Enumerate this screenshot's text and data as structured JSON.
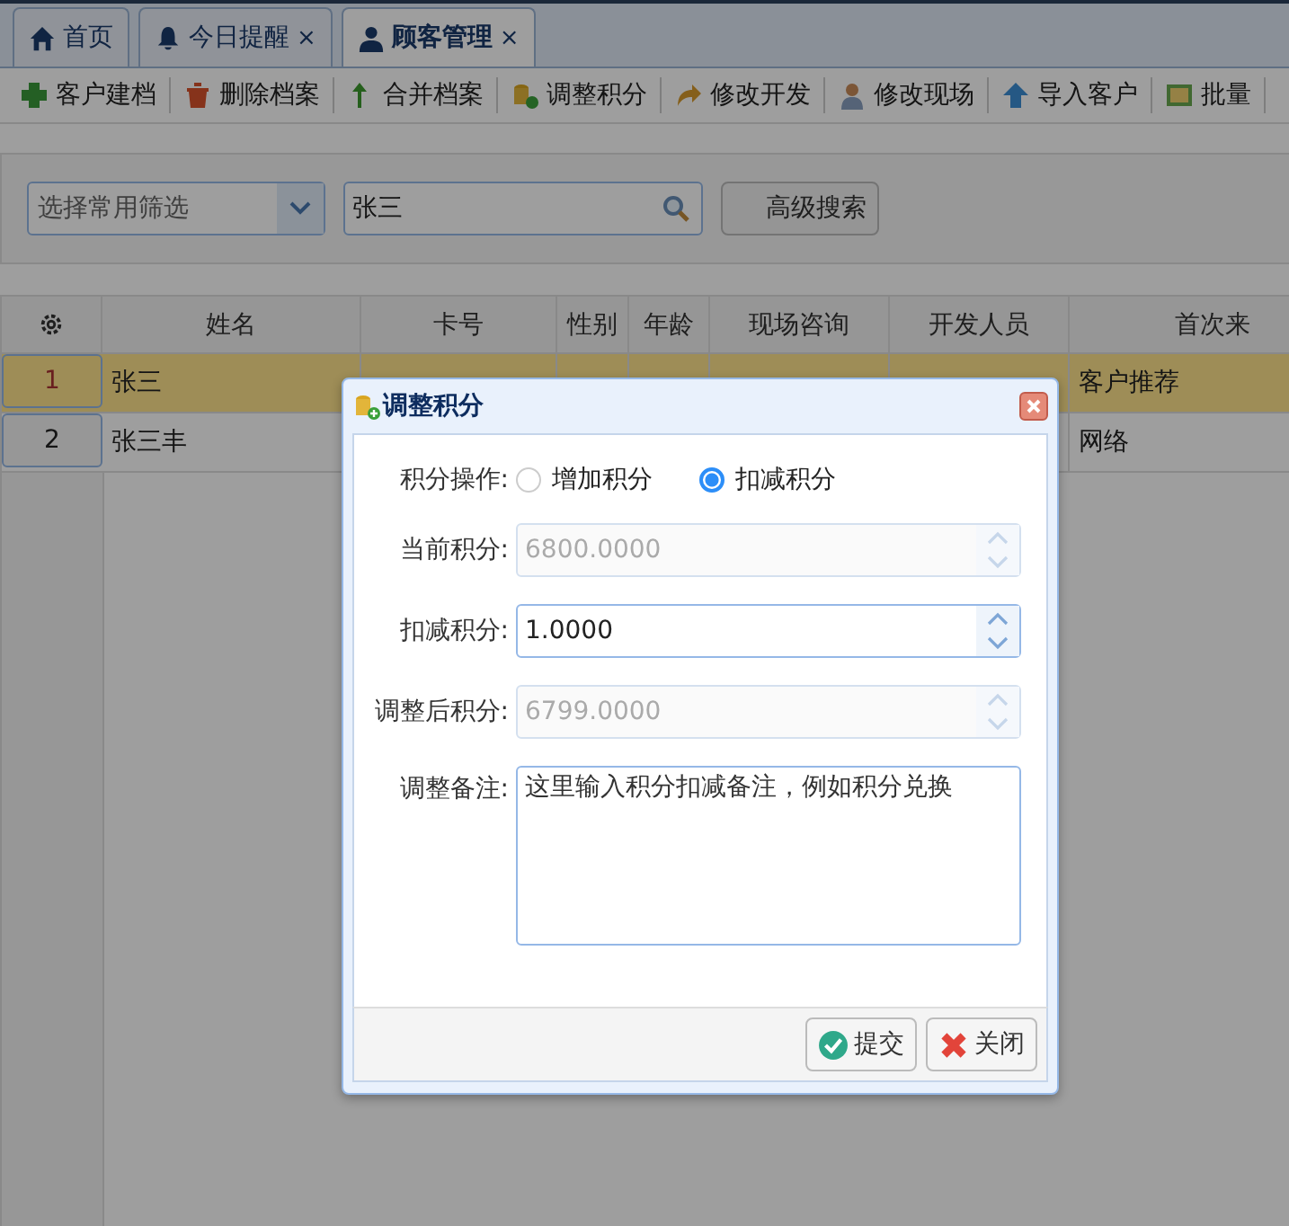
{
  "tabs": [
    {
      "label": "首页",
      "closable": false,
      "selected": false
    },
    {
      "label": "今日提醒",
      "closable": true,
      "selected": false
    },
    {
      "label": "顾客管理",
      "closable": true,
      "selected": true
    }
  ],
  "close_glyph": "×",
  "toolbar": [
    "客户建档",
    "删除档案",
    "合并档案",
    "调整积分",
    "修改开发",
    "修改现场",
    "导入客户",
    "批量"
  ],
  "search": {
    "filter_placeholder": "选择常用筛选",
    "query": "张三",
    "button": "高级搜索"
  },
  "table": {
    "columns": [
      "",
      "姓名",
      "卡号",
      "性别",
      "年龄",
      "现场咨询",
      "开发人员",
      "首次来"
    ],
    "rows": [
      {
        "selected": true,
        "cells": [
          "1",
          "张三",
          null,
          null,
          null,
          null,
          null,
          "客户推荐"
        ]
      },
      {
        "selected": false,
        "cells": [
          "2",
          "张三丰",
          null,
          null,
          null,
          null,
          null,
          "网络"
        ]
      }
    ]
  },
  "dialog": {
    "title": "调整积分",
    "operation": {
      "label": "积分操作:",
      "options": [
        {
          "label": "增加积分",
          "selected": false
        },
        {
          "label": "扣减积分",
          "selected": true
        }
      ]
    },
    "fields": [
      {
        "label": "当前积分:",
        "value": "6800.0000",
        "disabled": true
      },
      {
        "label": "扣减积分:",
        "value": "1.0000",
        "disabled": false
      },
      {
        "label": "调整后积分:",
        "value": "6799.0000",
        "disabled": true
      }
    ],
    "remark": {
      "label": "调整备注:",
      "value": "这里输入积分扣减备注，例如积分兑换"
    },
    "buttons": [
      {
        "label": "提交",
        "kind": "submit"
      },
      {
        "label": "关闭",
        "kind": "close"
      }
    ]
  }
}
